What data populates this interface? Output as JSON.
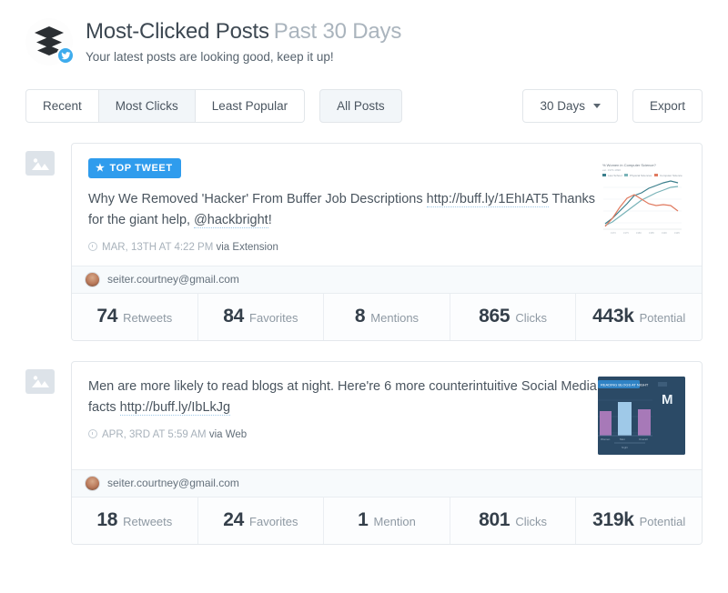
{
  "header": {
    "logo_icon": "buffer-layers-icon",
    "network_badge_icon": "twitter-icon",
    "title": "Most-Clicked Posts",
    "title_suffix": "Past 30 Days",
    "subtitle": "Your latest posts are looking good, keep it up!"
  },
  "toolbar": {
    "sort_buttons": [
      {
        "label": "Recent",
        "active": false
      },
      {
        "label": "Most Clicks",
        "active": true
      },
      {
        "label": "Least Popular",
        "active": false
      }
    ],
    "filter_button": {
      "label": "All Posts",
      "active": true
    },
    "range_select": {
      "value": "30 Days",
      "caret_icon": "chevron-down-icon"
    },
    "export_button": {
      "label": "Export"
    }
  },
  "posts": [
    {
      "placeholder_icon": "image-placeholder-icon",
      "badge": {
        "label": "TOP TWEET",
        "star_icon": "star-icon",
        "color": "#2f9ced"
      },
      "text_part1": "Why We Removed 'Hacker' From Buffer Job Descriptions ",
      "link": "http://buff.ly/1EhIAT5",
      "text_part2": " Thanks for the giant help, ",
      "mention": "@hackbright",
      "text_part3": "!",
      "clock_icon": "clock-icon",
      "timestamp": "MAR, 13TH AT 4:22 PM",
      "via": "via Extension",
      "preview_icon": "line-chart-thumbnail",
      "account": {
        "avatar_icon": "user-avatar",
        "email": "seiter.courtney@gmail.com"
      },
      "stats": [
        {
          "value": "74",
          "label": "Retweets"
        },
        {
          "value": "84",
          "label": "Favorites"
        },
        {
          "value": "8",
          "label": "Mentions"
        },
        {
          "value": "865",
          "label": "Clicks"
        },
        {
          "value": "443k",
          "label": "Potential"
        }
      ]
    },
    {
      "placeholder_icon": "image-placeholder-icon",
      "badge": null,
      "text_part1": "Men are more likely to read blogs at night. Here're 6 more counterintuitive Social Media facts ",
      "link": "http://buff.ly/IbLkJg",
      "text_part2": "",
      "mention": "",
      "text_part3": "",
      "clock_icon": "clock-icon",
      "timestamp": "APR, 3RD AT 5:59 AM",
      "via": "via Web",
      "preview_icon": "bar-chart-infographic-thumbnail",
      "preview_caption": "READING BLOGS AT NIGHT",
      "account": {
        "avatar_icon": "user-avatar",
        "email": "seiter.courtney@gmail.com"
      },
      "stats": [
        {
          "value": "18",
          "label": "Retweets"
        },
        {
          "value": "24",
          "label": "Favorites"
        },
        {
          "value": "1",
          "label": "Mention"
        },
        {
          "value": "801",
          "label": "Clicks"
        },
        {
          "value": "319k",
          "label": "Potential"
        }
      ]
    }
  ],
  "colors": {
    "accent_blue": "#2f9ced",
    "twitter_blue": "#3eaced",
    "text_dark": "#3d4852",
    "text_muted": "#a8b2bb",
    "border": "#e4e8ec",
    "active_fill": "#f2f6f9"
  }
}
